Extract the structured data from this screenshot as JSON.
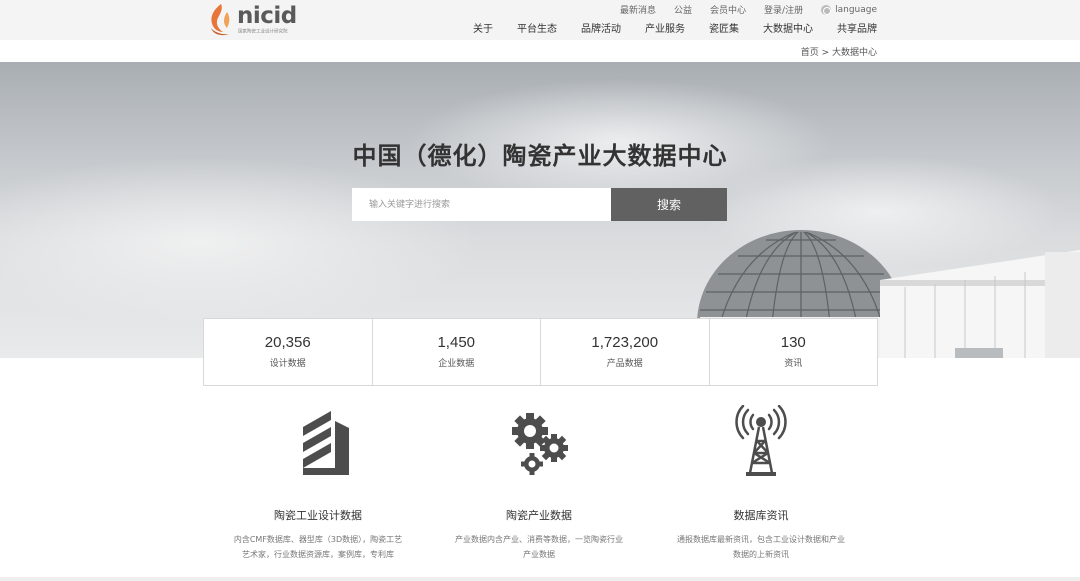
{
  "header": {
    "logo_text": "nicid",
    "logo_subtitle": "国家陶瓷工业设计研究院",
    "top_links": [
      "最新消息",
      "公益",
      "会员中心",
      "登录/注册"
    ],
    "language_label": "language",
    "nav": [
      "关于",
      "平台生态",
      "品牌活动",
      "产业服务",
      "瓷匠集",
      "大数据中心",
      "共享品牌"
    ]
  },
  "breadcrumb": "首页 > 大数据中心",
  "hero": {
    "title": "中国（德化）陶瓷产业大数据中心",
    "search_placeholder": "输入关键字进行搜索",
    "search_button": "搜索"
  },
  "stats": [
    {
      "value": "20,356",
      "label": "设计数据"
    },
    {
      "value": "1,450",
      "label": "企业数据"
    },
    {
      "value": "1,723,200",
      "label": "产品数据"
    },
    {
      "value": "130",
      "label": "资讯"
    }
  ],
  "features": [
    {
      "title": "陶瓷工业设计数据",
      "desc1": "内含CMF数据库、器型库（3D数据），陶瓷工艺",
      "desc2": "艺术家，行业数据资源库，案例库，专利库"
    },
    {
      "title": "陶瓷产业数据",
      "desc1": "产业数据内含产业、消费等数据，一览陶瓷行业",
      "desc2": "产业数据"
    },
    {
      "title": "数据库资讯",
      "desc1": "通报数据库最新资讯，包含工业设计数据和产业",
      "desc2": "数据的上新资讯"
    }
  ],
  "colors": {
    "button_bg": "#616161",
    "logo_orange": "#e8753a"
  }
}
